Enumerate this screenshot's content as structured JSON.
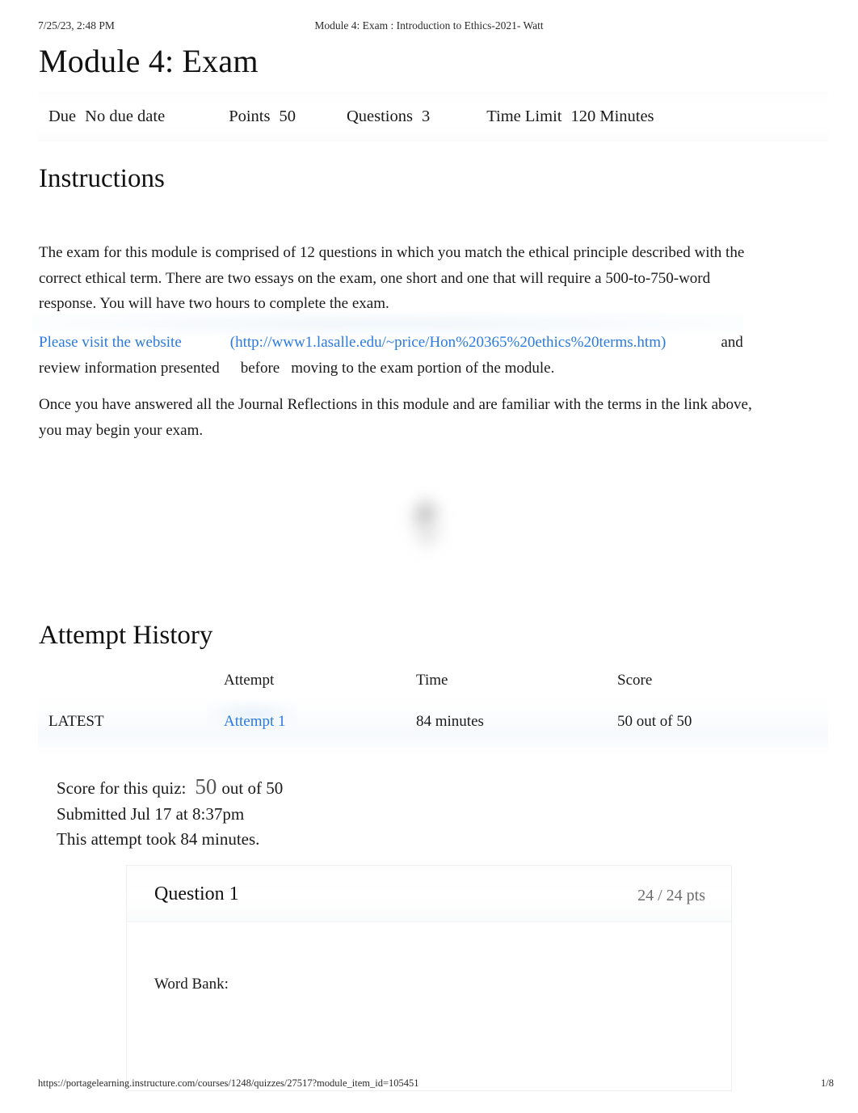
{
  "print_header": {
    "date": "7/25/23, 2:48 PM",
    "document_title": "Module 4: Exam : Introduction to Ethics-2021- Watt"
  },
  "print_footer": {
    "url": "https://portagelearning.instructure.com/courses/1248/quizzes/27517?module_item_id=105451",
    "page": "1/8"
  },
  "quiz": {
    "title": "Module 4: Exam",
    "meta": {
      "due_label": "Due",
      "due_value": "No due date",
      "points_label": "Points",
      "points_value": "50",
      "questions_label": "Questions",
      "questions_value": "3",
      "time_limit_label": "Time Limit",
      "time_limit_value": "120 Minutes"
    }
  },
  "instructions": {
    "heading": "Instructions",
    "paragraph_1": "The exam for this module is comprised of 12 questions in which you match the ethical principle described with the correct ethical term. There are two essays on the exam, one short and one that will require a 500-to-750-word response. You will have two hours to complete the exam.",
    "link_lead_text": "Please visit the website",
    "link_url_text": "(http://www1.lasalle.edu/~price/Hon%20365%20ethics%20terms.htm)",
    "link_trailing_and": "and",
    "link_line2_a": "review information presented",
    "link_line2_b": "before",
    "link_line2_c": "moving to the exam portion of the module.",
    "paragraph_3": "Once you have answered all the Journal Reflections in this module and are familiar with the terms in the link above, you may begin your exam."
  },
  "attempt_history": {
    "heading": "Attempt History",
    "columns": [
      "",
      "Attempt",
      "Time",
      "Score"
    ],
    "rows": [
      {
        "status": "LATEST",
        "attempt": "Attempt 1",
        "time": "84 minutes",
        "score": "50 out of 50"
      }
    ]
  },
  "score_summary": {
    "score_label": "Score for this quiz:",
    "score_value": "50",
    "score_out_of": "out of 50",
    "submitted": "Submitted Jul 17 at 8:37pm",
    "duration": "This attempt took 84 minutes."
  },
  "question": {
    "title": "Question 1",
    "points": "24 / 24 pts",
    "word_bank_label": "Word Bank:"
  },
  "colors": {
    "link": "#2b7ae0",
    "text": "#1a1a1a",
    "muted": "#6b6b6b",
    "score_value": "#585858",
    "box_border": "#eceef0"
  }
}
